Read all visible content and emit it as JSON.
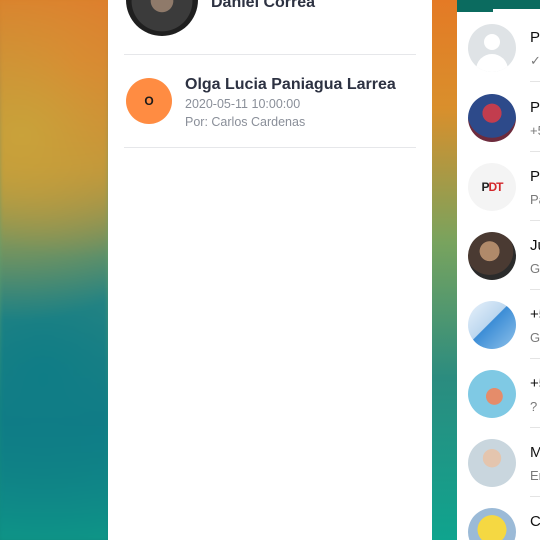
{
  "background_colors": {
    "panel": "#ffffff",
    "accent_orange": "#ff8c42",
    "whatsapp_green": "#0b6b5f"
  },
  "left_panel": {
    "entries": [
      {
        "name": "Daniel Correa",
        "avatar": "photo-avatar",
        "meta_lines": []
      },
      {
        "name": "Olga Lucia Paniagua Larrea",
        "avatar_letter": "O",
        "datetime": "2020-05-11 10:00:00",
        "author": "Por: Carlos Cardenas"
      }
    ]
  },
  "right_list": {
    "rows": [
      {
        "initial": "P",
        "snippet": "✓✓",
        "avatar": "default-avatar"
      },
      {
        "initial": "P",
        "snippet": "+5",
        "avatar": "sports-avatar"
      },
      {
        "initial": "P",
        "snippet": "Pa",
        "avatar": "pdt-logo",
        "logo_text_1": "P",
        "logo_text_2": "DT"
      },
      {
        "initial": "Ju",
        "snippet": "G",
        "avatar": "couple-avatar"
      },
      {
        "initial": "+5",
        "snippet": "G",
        "avatar": "card-avatar"
      },
      {
        "initial": "+5",
        "snippet": "?",
        "avatar": "beach-avatar"
      },
      {
        "initial": "M",
        "snippet": "Er",
        "avatar": "man-avatar"
      },
      {
        "initial": "C",
        "snippet": "+",
        "avatar": "minion-avatar"
      }
    ]
  }
}
